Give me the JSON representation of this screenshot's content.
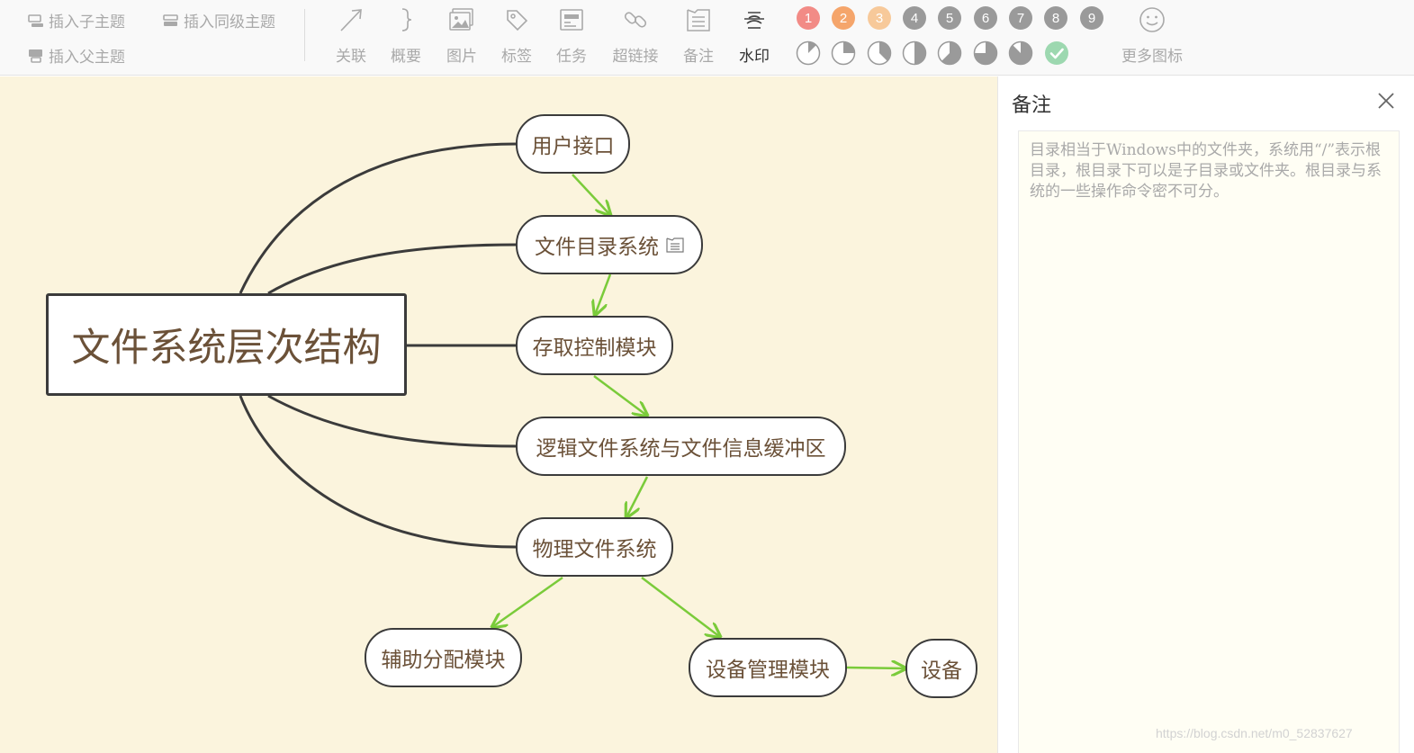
{
  "toolbar": {
    "insert_child": "插入子主题",
    "insert_sibling": "插入同级主题",
    "insert_parent": "插入父主题",
    "tools": {
      "relation": "关联",
      "summary": "概要",
      "image": "图片",
      "tag": "标签",
      "task": "任务",
      "hyperlink": "超链接",
      "note": "备注",
      "watermark": "水印"
    },
    "active_tool": "watermark",
    "priorities": [
      "1",
      "2",
      "3",
      "4",
      "5",
      "6",
      "7",
      "8",
      "9"
    ],
    "priority_colors": [
      "#f28b86",
      "#f5a56b",
      "#f7c99a",
      "#9a9a9a",
      "#9a9a9a",
      "#9a9a9a",
      "#9a9a9a",
      "#9a9a9a",
      "#9a9a9a"
    ],
    "progress_levels": [
      "1/8",
      "2/8",
      "3/8",
      "4/8",
      "5/8",
      "6/8",
      "7/8",
      "done"
    ],
    "more_icons": "更多图标"
  },
  "mindmap": {
    "root": "文件系统层次结构",
    "nodes": {
      "n1": "用户接口",
      "n2": "文件目录系统",
      "n3": "存取控制模块",
      "n4": "逻辑文件系统与文件信息缓冲区",
      "n5": "物理文件系统",
      "n6": "辅助分配模块",
      "n7": "设备管理模块",
      "n8": "设备"
    },
    "node_with_note": "n2",
    "colors": {
      "canvas_bg": "#fbf4dd",
      "branch": "#3b3b3b",
      "arrow": "#7acb3a",
      "text": "#6b5138"
    }
  },
  "notes_panel": {
    "title": "备注",
    "content": "目录相当于Windows中的文件夹，系统用“/”表示根目录，根目录下可以是子目录或文件夹。根目录与系统的一些操作命令密不可分。"
  },
  "watermark": "https://blog.csdn.net/m0_52837627"
}
